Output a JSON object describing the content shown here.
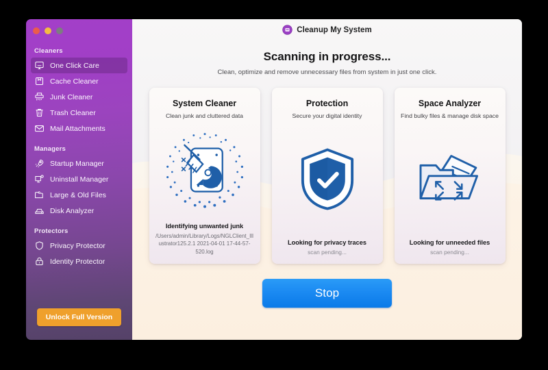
{
  "window": {
    "traffic_lights": [
      "close",
      "minimize",
      "zoom"
    ],
    "app_title": "Cleanup My System",
    "app_icon": "app-logo-icon"
  },
  "sidebar": {
    "unlock_label": "Unlock Full Version",
    "sections": [
      {
        "title": "Cleaners",
        "items": [
          {
            "label": "One Click Care",
            "icon": "monitor-icon",
            "active": true
          },
          {
            "label": "Cache Cleaner",
            "icon": "box-icon",
            "active": false
          },
          {
            "label": "Junk Cleaner",
            "icon": "shredder-icon",
            "active": false
          },
          {
            "label": "Trash Cleaner",
            "icon": "trash-icon",
            "active": false
          },
          {
            "label": "Mail Attachments",
            "icon": "envelope-icon",
            "active": false
          }
        ]
      },
      {
        "title": "Managers",
        "items": [
          {
            "label": "Startup Manager",
            "icon": "rocket-icon",
            "active": false
          },
          {
            "label": "Uninstall Manager",
            "icon": "monitor-gear-icon",
            "active": false
          },
          {
            "label": "Large & Old Files",
            "icon": "folder-files-icon",
            "active": false
          },
          {
            "label": "Disk Analyzer",
            "icon": "disk-icon",
            "active": false
          }
        ]
      },
      {
        "title": "Protectors",
        "items": [
          {
            "label": "Privacy Protector",
            "icon": "shield-icon",
            "active": false
          },
          {
            "label": "Identity Protector",
            "icon": "lock-icon",
            "active": false
          }
        ]
      }
    ]
  },
  "main": {
    "headline": "Scanning in progress...",
    "subhead": "Clean, optimize and remove unnecessary files from system in just one click.",
    "stop_label": "Stop",
    "cards": [
      {
        "title": "System Cleaner",
        "subtitle": "Clean junk and cluttered data",
        "art": "broom-dotted-icon",
        "status": "Identifying unwanted junk",
        "detail": "/Users/admin/Library/Logs/NGLClient_Illustrator125.2.1 2021-04-01 17-44-57-520.log",
        "pending": ""
      },
      {
        "title": "Protection",
        "subtitle": "Secure your digital identity",
        "art": "shield-check-icon",
        "status": "Looking for privacy traces",
        "detail": "",
        "pending": "scan pending..."
      },
      {
        "title": "Space Analyzer",
        "subtitle": "Find bulky files & manage disk space",
        "art": "folder-expand-icon",
        "status": "Looking for unneeded files",
        "detail": "",
        "pending": "scan pending..."
      }
    ]
  },
  "colors": {
    "sidebar_top": "#a33fc9",
    "sidebar_bottom": "#554268",
    "accent_orange": "#efa02c",
    "accent_blue": "#1b8af2",
    "art_blue": "#1f5fa8",
    "canvas_cream": "#fdf1e2"
  }
}
